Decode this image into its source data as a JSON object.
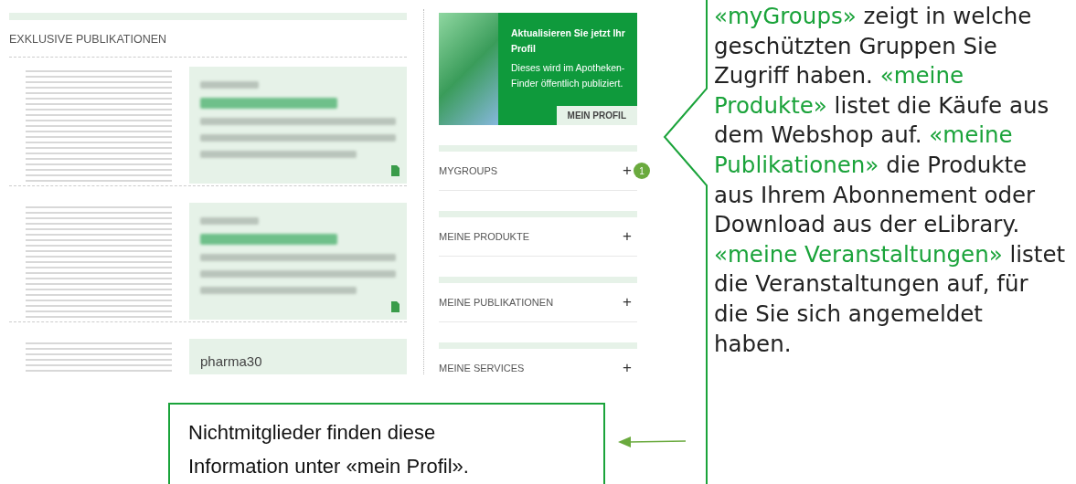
{
  "page": {
    "section_title": "EXKLUSIVE PUBLIKATIONEN",
    "publications": [
      {
        "kind": "blurred"
      },
      {
        "kind": "blurred"
      },
      {
        "kind": "labeled",
        "label": "pharma30"
      }
    ],
    "promo": {
      "title": "Aktualisieren Sie jetzt Ihr Profil",
      "text": "Dieses wird im Apotheken-Finder öffentlich publiziert.",
      "button": "MEIN PROFIL"
    },
    "accordion": [
      {
        "label": "MYGROUPS",
        "toggle": "+",
        "badge": "1"
      },
      {
        "label": "MEINE PRODUKTE",
        "toggle": "+"
      },
      {
        "label": "MEINE PUBLIKATIONEN",
        "toggle": "+"
      },
      {
        "label": "MEINE SERVICES",
        "toggle": "+"
      }
    ]
  },
  "callouts": {
    "side": {
      "segments": [
        {
          "kind": "term",
          "text": "«myGroups»"
        },
        {
          "kind": "text",
          "text": " zeigt in welche geschützten Gruppen Sie Zugriff haben. "
        },
        {
          "kind": "term",
          "text": "«meine Produkte»"
        },
        {
          "kind": "text",
          "text": " listet die Käufe aus dem Webshop auf. "
        },
        {
          "kind": "term",
          "text": "«meine Publikationen»"
        },
        {
          "kind": "text",
          "text": " die Produkte aus Ihrem Abonnement oder Download aus der eLibrary. "
        },
        {
          "kind": "term",
          "text": "«meine Veranstaltungen»"
        },
        {
          "kind": "text",
          "text": " listet die Veranstaltungen auf, für die Sie sich angemeldet haben."
        }
      ]
    },
    "bottom": {
      "text": "Nichtmitglieder finden diese Information unter «mein Profil»."
    }
  }
}
